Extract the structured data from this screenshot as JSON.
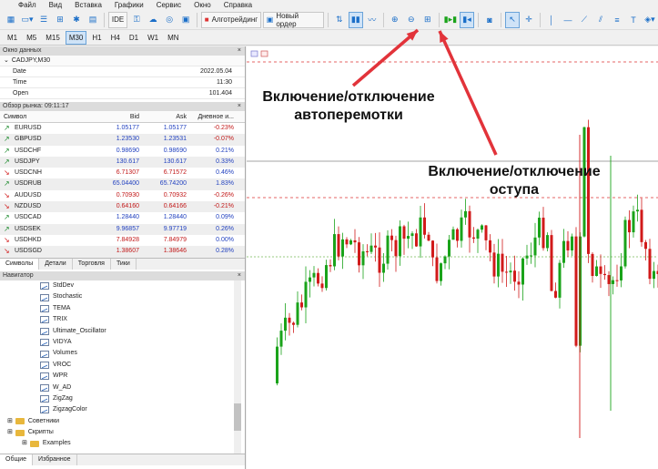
{
  "menu": [
    "Файл",
    "Вид",
    "Вставка",
    "Графики",
    "Сервис",
    "Окно",
    "Справка"
  ],
  "toolbar": {
    "ide": "IDE",
    "algo": "Алготрейдинг",
    "new_order": "Новый ордер"
  },
  "timeframes": [
    "M1",
    "M5",
    "M15",
    "M30",
    "H1",
    "H4",
    "D1",
    "W1",
    "MN"
  ],
  "selected_timeframe": "M30",
  "data_window": {
    "title": "Окно данных",
    "symbol": "CADJPY,M30",
    "rows": [
      {
        "k": "Date",
        "v": "2022.05.04"
      },
      {
        "k": "Time",
        "v": "11:30"
      },
      {
        "k": "Open",
        "v": "101.404"
      }
    ]
  },
  "market_watch": {
    "title": "Обзор рынка: 09:11:17",
    "headers": [
      "Символ",
      "Bid",
      "Ask",
      "Дневное и..."
    ],
    "rows": [
      {
        "sym": "EURUSD",
        "dir": "up",
        "bid": "1.05177",
        "ask": "1.05177",
        "chg": "-0.23%"
      },
      {
        "sym": "GBPUSD",
        "dir": "up",
        "bid": "1.23530",
        "ask": "1.23531",
        "chg": "-0.07%"
      },
      {
        "sym": "USDCHF",
        "dir": "up",
        "bid": "0.98690",
        "ask": "0.98690",
        "chg": "0.21%"
      },
      {
        "sym": "USDJPY",
        "dir": "up",
        "bid": "130.617",
        "ask": "130.617",
        "chg": "0.33%"
      },
      {
        "sym": "USDCNH",
        "dir": "dn",
        "bid": "6.71307",
        "ask": "6.71572",
        "chg": "0.46%"
      },
      {
        "sym": "USDRUB",
        "dir": "up",
        "bid": "65.04400",
        "ask": "65.74200",
        "chg": "1.83%"
      },
      {
        "sym": "AUDUSD",
        "dir": "dn",
        "bid": "0.70930",
        "ask": "0.70932",
        "chg": "-0.26%"
      },
      {
        "sym": "NZDUSD",
        "dir": "dn",
        "bid": "0.64160",
        "ask": "0.64166",
        "chg": "-0.21%"
      },
      {
        "sym": "USDCAD",
        "dir": "up",
        "bid": "1.28440",
        "ask": "1.28440",
        "chg": "0.09%"
      },
      {
        "sym": "USDSEK",
        "dir": "up",
        "bid": "9.96857",
        "ask": "9.97719",
        "chg": "0.26%"
      },
      {
        "sym": "USDHKD",
        "dir": "dn",
        "bid": "7.84928",
        "ask": "7.84979",
        "chg": "0.00%"
      },
      {
        "sym": "USDSGD",
        "dir": "dn",
        "bid": "1.38607",
        "ask": "1.38646",
        "chg": "0.28%"
      }
    ],
    "tabs": [
      "Символы",
      "Детали",
      "Торговля",
      "Тики"
    ]
  },
  "navigator": {
    "title": "Навигатор",
    "indicators": [
      "StdDev",
      "Stochastic",
      "TEMA",
      "TRIX",
      "Ultimate_Oscillator",
      "VIDYA",
      "Volumes",
      "VROC",
      "WPR",
      "W_AD",
      "ZigZag",
      "ZigzagColor"
    ],
    "advisors": "Советники",
    "scripts": "Скрипты",
    "examples": "Examples",
    "tabs": [
      "Общие",
      "Избранное"
    ]
  },
  "annotations": {
    "autoscroll": [
      "Включение/отключение",
      "автоперемотки"
    ],
    "shift": [
      "Включение/отключение",
      "оступа"
    ]
  },
  "colors": {
    "bull": "#1aa31a",
    "bear": "#d11a1a",
    "arrow": "#e2333a"
  }
}
